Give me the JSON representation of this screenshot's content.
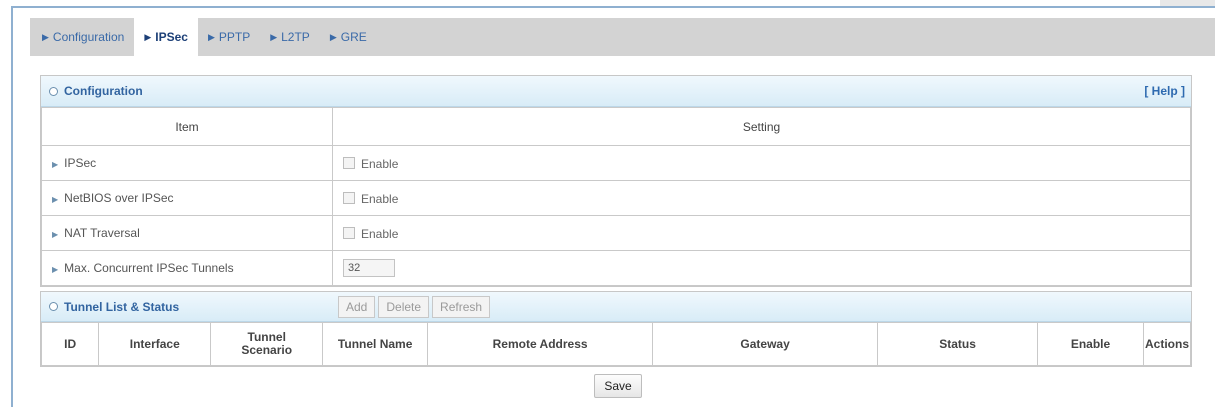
{
  "tabs": [
    {
      "label": "Configuration",
      "active": false
    },
    {
      "label": "IPSec",
      "active": true
    },
    {
      "label": "PPTP",
      "active": false
    },
    {
      "label": "L2TP",
      "active": false
    },
    {
      "label": "GRE",
      "active": false
    }
  ],
  "configuration": {
    "title": "Configuration",
    "help_label": "[ Help ]",
    "col_item": "Item",
    "col_setting": "Setting",
    "rows": [
      {
        "label": "IPSec",
        "checkbox_label": "Enable",
        "checked": false
      },
      {
        "label": "NetBIOS over IPSec",
        "checkbox_label": "Enable",
        "checked": false
      },
      {
        "label": "NAT Traversal",
        "checkbox_label": "Enable",
        "checked": false
      }
    ],
    "max_tunnels": {
      "label": "Max. Concurrent IPSec Tunnels",
      "value": "32"
    }
  },
  "tunnel_list": {
    "title": "Tunnel List & Status",
    "buttons": {
      "add": "Add",
      "delete": "Delete",
      "refresh": "Refresh"
    },
    "columns": {
      "id": "ID",
      "interface": "Interface",
      "scenario_line1": "Tunnel",
      "scenario_line2": "Scenario",
      "tunnel_name": "Tunnel Name",
      "remote_address": "Remote Address",
      "gateway": "Gateway",
      "status": "Status",
      "enable": "Enable",
      "actions": "Actions"
    }
  },
  "save_label": "Save",
  "colors": {
    "accent": "#3264a0",
    "tab_bar": "#d3d3d3",
    "panel_header": "#d8ecf7"
  }
}
